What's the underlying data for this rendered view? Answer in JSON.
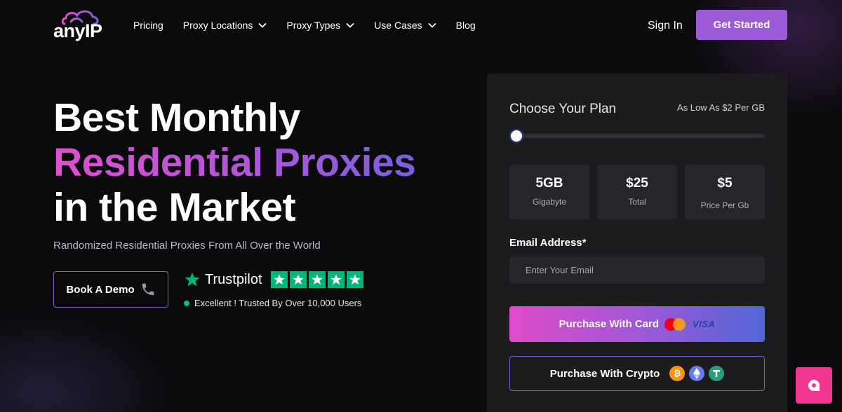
{
  "brand": {
    "name": "anyIP"
  },
  "nav": {
    "items": [
      {
        "label": "Pricing",
        "has_dropdown": false
      },
      {
        "label": "Proxy Locations",
        "has_dropdown": true
      },
      {
        "label": "Proxy Types",
        "has_dropdown": true
      },
      {
        "label": "Use Cases",
        "has_dropdown": true
      },
      {
        "label": "Blog",
        "has_dropdown": false
      }
    ],
    "sign_in": "Sign In",
    "get_started": "Get Started"
  },
  "hero": {
    "title_line1": "Best Monthly",
    "title_line2": "Residential Proxies",
    "title_line3": "in the Market",
    "subtitle": "Randomized Residential Proxies From All Over the World",
    "demo_button": "Book A Demo",
    "trustpilot": {
      "name": "Trustpilot",
      "stars": 5,
      "tagline": "Excellent ! Trusted By Over 10,000 Users"
    }
  },
  "plan": {
    "title": "Choose Your Plan",
    "price_note": "As Low As $2 Per GB",
    "slider_level": 0,
    "stats": [
      {
        "value": "5GB",
        "label": "Gigabyte"
      },
      {
        "value": "$25",
        "label": "Total"
      },
      {
        "value": "$5",
        "label": "Price Per Gb"
      }
    ],
    "email_label": "Email Address*",
    "email_placeholder": "Enter Your Email",
    "email_value": "",
    "card_button": "Purchase With Card",
    "card_visa": "VISA",
    "crypto_button": "Purchase With Crypto"
  },
  "colors": {
    "accent": "#9b5bd6",
    "trustpilot_green": "#00b67a",
    "chat": "#f0378f"
  },
  "icons": {
    "phone": "phone-icon",
    "chevron": "chevron-down-icon",
    "chat": "chat-icon",
    "mastercard": "mastercard-icon",
    "bitcoin": "bitcoin-icon",
    "ethereum": "ethereum-icon",
    "tether": "tether-icon"
  }
}
